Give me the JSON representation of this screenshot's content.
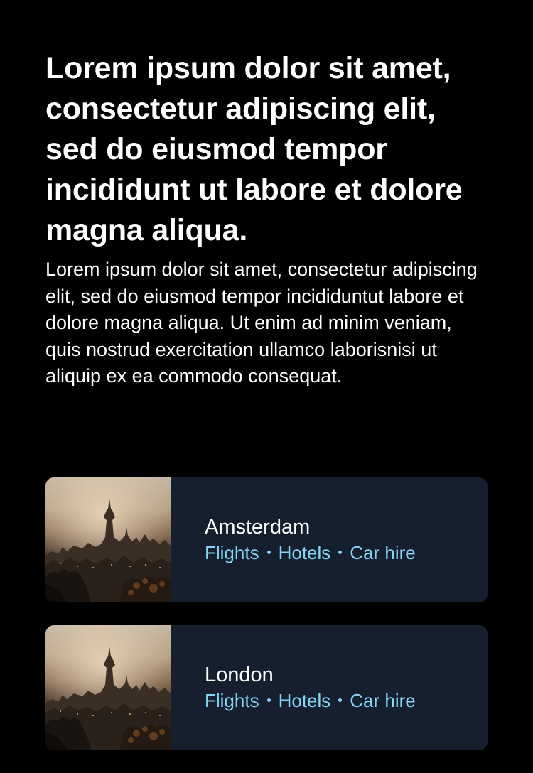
{
  "headline": "Lorem ipsum dolor sit amet, consectetur adipiscing elit, sed do eiusmod tempor incididunt ut labore et dolore magna aliqua.",
  "body": "Lorem ipsum dolor sit amet, consectetur adipiscing elit, sed do eiusmod tempor incididuntut labore et dolore magna aliqua. Ut enim ad minim veniam, quis nostrud exercitation ullamco laborisnisi ut aliquip ex ea commodo consequat.",
  "cards": [
    {
      "city": "Amsterdam",
      "image": "city-skyline-photo",
      "links": {
        "flights": "Flights",
        "hotels": "Hotels",
        "car_hire": "Car hire"
      }
    },
    {
      "city": "London",
      "image": "city-skyline-photo",
      "links": {
        "flights": "Flights",
        "hotels": "Hotels",
        "car_hire": "Car hire"
      }
    }
  ],
  "colors": {
    "background": "#000000",
    "card": "#161f2d",
    "link": "#84d4f3",
    "text": "#ffffff"
  }
}
